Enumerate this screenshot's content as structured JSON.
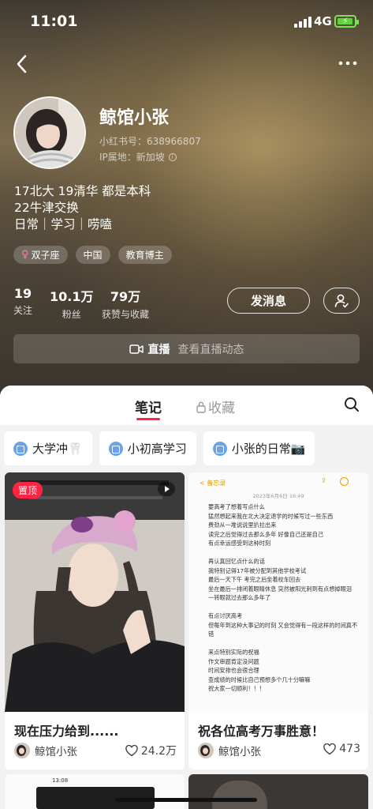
{
  "status_bar": {
    "time": "11:01",
    "network": "4G"
  },
  "profile": {
    "nickname": "鲸馆小张",
    "red_id": "小红书号：638966807",
    "ip_location": "IP属地：新加坡",
    "bio_lines": [
      "17北大 19清华 都是本科",
      "22牛津交换",
      "日常｜学习｜唠嗑"
    ],
    "tags": [
      "双子座",
      "中国",
      "教育博主"
    ],
    "stats": [
      {
        "value": "19",
        "label": "关注"
      },
      {
        "value": "10.1万",
        "label": "粉丝"
      },
      {
        "value": "79万",
        "label": "获赞与收藏"
      }
    ],
    "message_button": "发消息",
    "live": {
      "title": "直播",
      "subtitle": "查看直播动态"
    }
  },
  "tabs": {
    "notes": "笔记",
    "favorites": "收藏"
  },
  "collections": [
    "大学冲🦷",
    "小初高学习",
    "小张的日常📷"
  ],
  "cards": [
    {
      "badge": "置顶",
      "title": "现在压力给到......",
      "author": "鲸馆小张",
      "likes": "24.2万"
    },
    {
      "title": "祝各位高考万事胜意！",
      "author": "鲸馆小张",
      "likes": "473",
      "memo": {
        "back": "< 备忘录",
        "date": "2023年6月6日 16:49",
        "text": "要高考了想着写点什么\n猛然想起来我在北大决定退学的时候写过一些东西\n费劲从一堆说说里扒拉出来\n读完之后觉得过去那么多年 好像自己还是自己\n有点幸运感受到这种时刻\n\n再认真回忆点什么的话\n我特别记得17年被分配到其他学校考试\n最后一天下午 考完之后坐着校车回去\n坐在最后一排闭着眼睛休息 突然被阳光刺到有点想掉眼泪\n一转眼就过去那么多年了\n\n有点讨厌高考\n但每年到这种大事记的时刻 又会觉得有一段这样的时间真不错\n\n来点特别实际的祝福\n作文审题肯定没问题\n时间安排也会很合理\n查成绩的时候比自己预想多个几十分嘛嘛\n祝大家一切顺利！！！"
      }
    }
  ],
  "bottom_preview": {
    "time": "13:08"
  }
}
